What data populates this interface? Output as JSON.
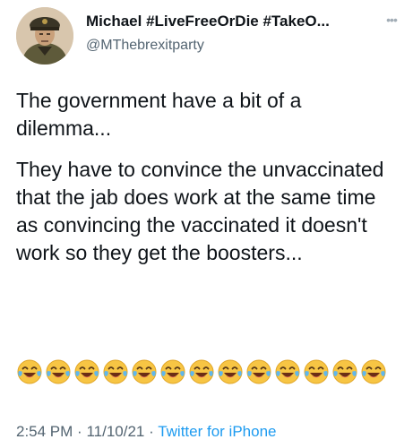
{
  "header": {
    "display_name": "Michael #LiveFreeOrDie #TakeO...",
    "handle": "@MThebrexitparty",
    "more_icon": "more-icon"
  },
  "tweet": {
    "paragraph_1": "The government have a bit of a dilemma...",
    "paragraph_2": "They have to convince the unvaccinated that the jab does work at the same time as convincing the vaccinated it doesn't work so they get the boosters...",
    "emoji_name": "face-with-tears-of-joy-emoji",
    "emoji_count": 13
  },
  "meta": {
    "time": "2:54 PM",
    "separator": "·",
    "date": "11/10/21",
    "source": "Twitter for iPhone"
  },
  "colors": {
    "text": "#0f1419",
    "secondary": "#536471",
    "link": "#1d9bf0"
  }
}
